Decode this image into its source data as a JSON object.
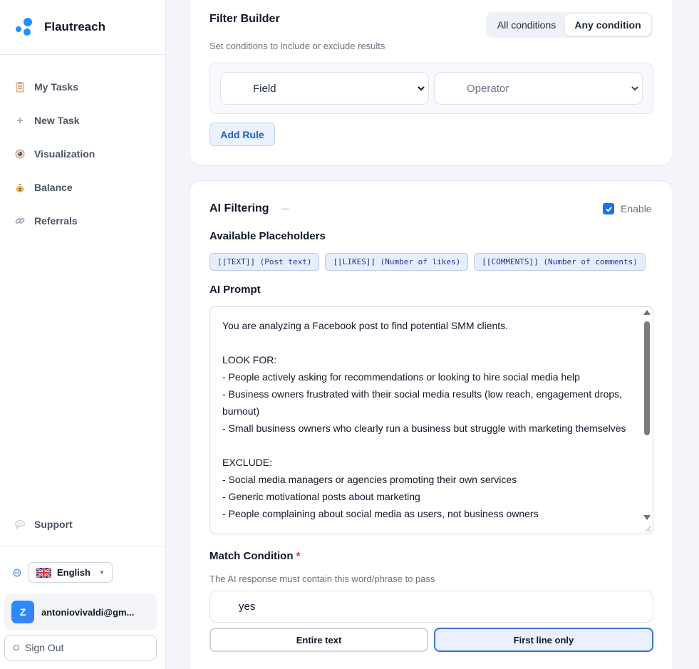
{
  "app": {
    "name": "Flautreach"
  },
  "sidebar": {
    "items": [
      {
        "label": "My Tasks",
        "icon": "clipboard-icon"
      },
      {
        "label": "New Task",
        "icon": "plus-icon"
      },
      {
        "label": "Visualization",
        "icon": "eye-icon"
      },
      {
        "label": "Balance",
        "icon": "money-bag-icon"
      },
      {
        "label": "Referrals",
        "icon": "link-icon"
      }
    ],
    "support": {
      "label": "Support",
      "icon": "speech-bubble-icon"
    },
    "language": {
      "selected": "English",
      "icon": "uk-flag-icon"
    },
    "user": {
      "initial": "Z",
      "email": "antoniovivaldi@gm..."
    },
    "sign_out": "Sign Out"
  },
  "filter_builder": {
    "title": "Filter Builder",
    "subtitle": "Set conditions to include or exclude results",
    "mode_options": [
      "All conditions",
      "Any condition"
    ],
    "mode_selected": "Any condition",
    "field_placeholder": "Field",
    "operator_placeholder": "Operator",
    "add_rule": "Add Rule"
  },
  "ai_filtering": {
    "title": "AI Filtering",
    "enabled": true,
    "enable_label": "Enable",
    "placeholders_title": "Available Placeholders",
    "placeholders": [
      "[[TEXT]] (Post text)",
      "[[LIKES]] (Number of likes)",
      "[[COMMENTS]] (Number of comments)"
    ],
    "prompt_title": "AI Prompt",
    "prompt_text": "You are analyzing a Facebook post to find potential SMM clients.\n\nLOOK FOR:\n- People actively asking for recommendations or looking to hire social media help\n- Business owners frustrated with their social media results (low reach, engagement drops, burnout)\n- Small business owners who clearly run a business but struggle with marketing themselves\n\nEXCLUDE:\n- Social media managers or agencies promoting their own services\n- Generic motivational posts about marketing\n- People complaining about social media as users, not business owners",
    "match_title": "Match Condition",
    "match_required": "*",
    "match_hint": "The AI response must contain this word/phrase to pass",
    "match_value": "yes",
    "match_modes": [
      "Entire text",
      "First line only"
    ],
    "match_mode_selected": "First line only"
  },
  "colors": {
    "accent": "#1e90ff",
    "checkbox": "#1a73e8",
    "chip_bg": "#e6eefc",
    "selected_btn_border": "#3b6fd4"
  }
}
